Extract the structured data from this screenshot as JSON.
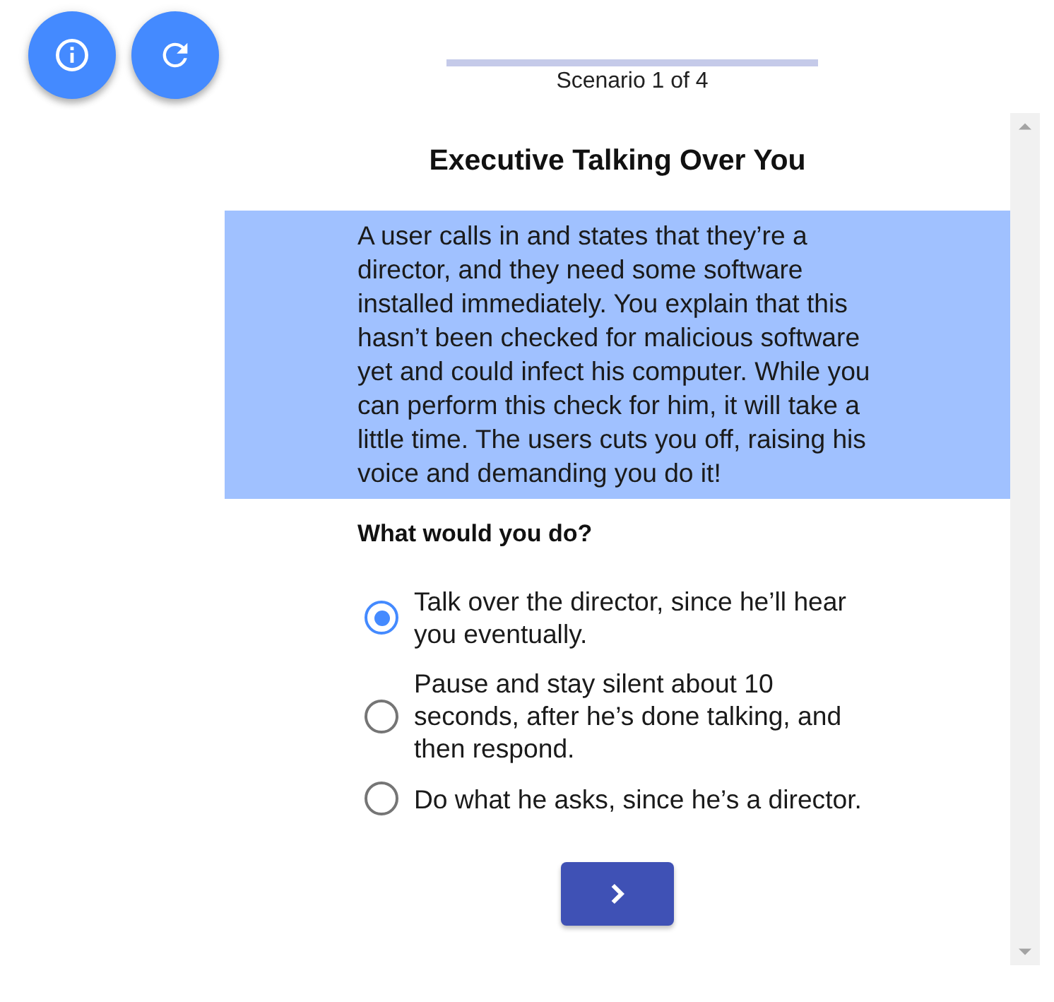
{
  "progress": {
    "level": 0,
    "label": "Scenario 1 of 4"
  },
  "scenario": {
    "title": "Executive Talking Over You",
    "description": "A user calls in and states that they’re a director, and they need some software installed immediately. You explain that this hasn’t been checked for malicious software yet and could infect his computer. While you can perform this check for him, it will take a little time. The users cuts you off, raising his voice and demanding you do it!",
    "question": "What would you do?",
    "options": [
      {
        "label": "Talk over the director, since he’ll hear you eventually.",
        "selected": true
      },
      {
        "label": "Pause and stay silent about 10 seconds, after he’s done talking, and then respond.",
        "selected": false
      },
      {
        "label": "Do what he asks, since he’s a director.",
        "selected": false
      }
    ]
  }
}
